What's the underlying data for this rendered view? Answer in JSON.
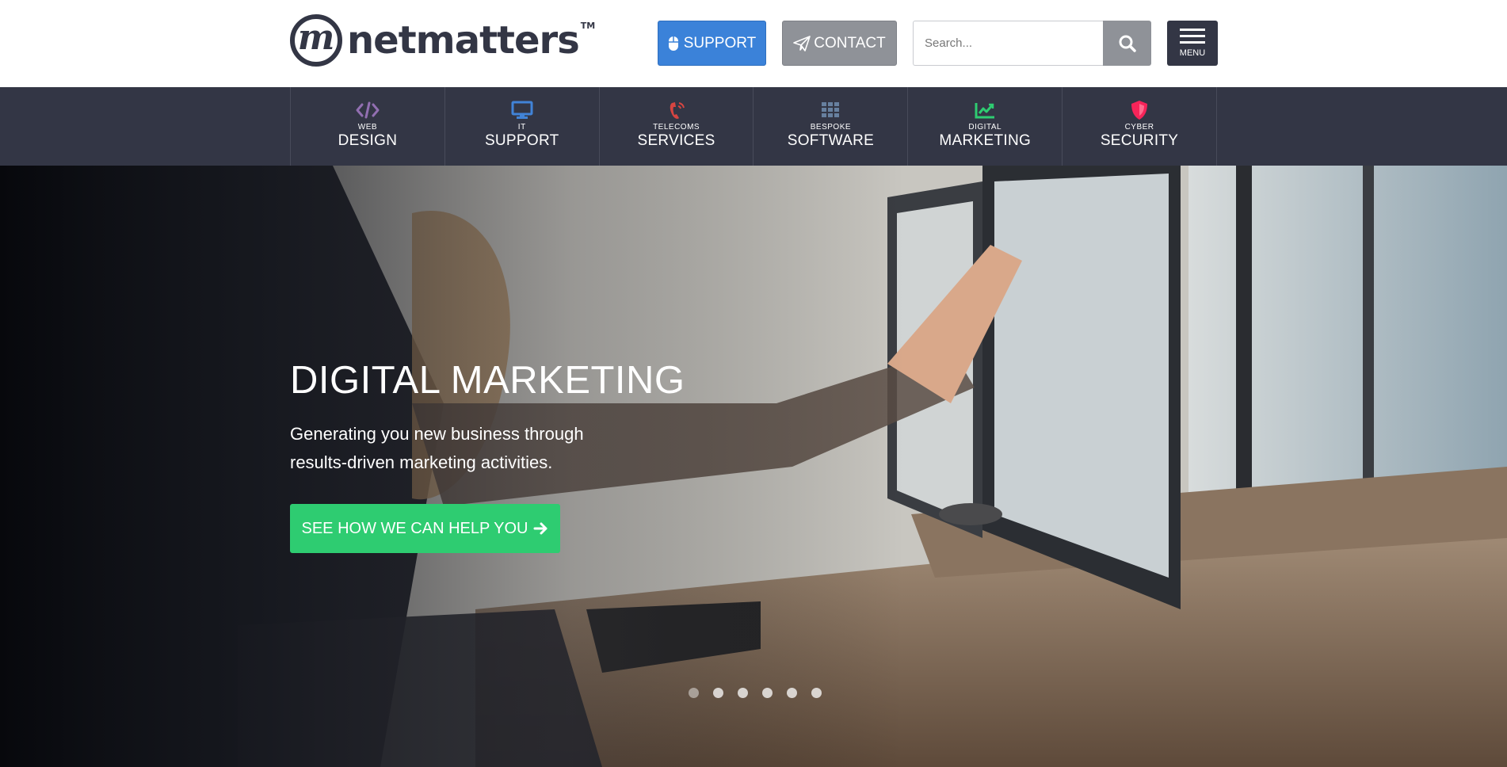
{
  "header": {
    "logo_text": "netmatters",
    "logo_mark": "m",
    "logo_tm": "TM",
    "support_label": "SUPPORT",
    "contact_label": "CONTACT",
    "search_placeholder": "Search...",
    "menu_label": "MENU"
  },
  "services": [
    {
      "small": "WEB",
      "big": "DESIGN",
      "icon": "code-icon",
      "color": "#926fb1"
    },
    {
      "small": "IT",
      "big": "SUPPORT",
      "icon": "monitor-icon",
      "color": "#4183d7"
    },
    {
      "small": "TELECOMS",
      "big": "SERVICES",
      "icon": "phone-icon",
      "color": "#d64541"
    },
    {
      "small": "BESPOKE",
      "big": "SOFTWARE",
      "icon": "grid-icon",
      "color": "#67809f"
    },
    {
      "small": "DIGITAL",
      "big": "MARKETING",
      "icon": "chart-icon",
      "color": "#2ecc71"
    },
    {
      "small": "CYBER",
      "big": "SECURITY",
      "icon": "shield-icon",
      "color": "#f62459"
    }
  ],
  "hero": {
    "title": "DIGITAL MARKETING",
    "subtitle": "Generating you new business through results-driven marketing activities.",
    "cta_label": "SEE HOW WE CAN HELP YOU",
    "slide_count": 6,
    "active_slide": 1
  },
  "colors": {
    "nav_bg": "#333645",
    "support_blue": "#3b82d9",
    "contact_grey": "#8f9298",
    "cta_green": "#2ecc71"
  }
}
